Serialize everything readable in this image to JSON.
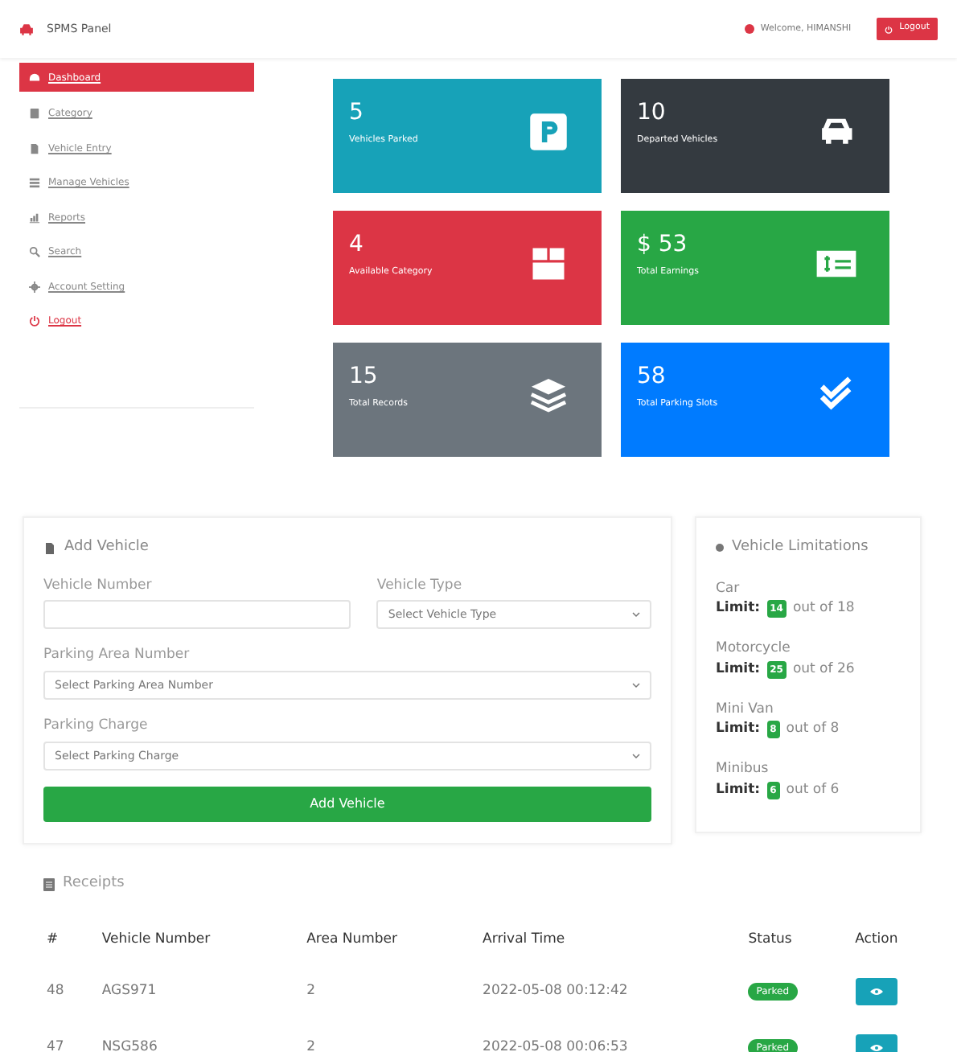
{
  "navbar": {
    "brand": "SPMS Panel",
    "welcome": "Welcome, HIMANSHI",
    "logout": "Logout"
  },
  "sidebar": {
    "items": [
      {
        "label": "Dashboard",
        "kind": "dashboard",
        "selected": true
      },
      {
        "label": "Category",
        "kind": "category",
        "selected": false
      },
      {
        "label": "Vehicle Entry",
        "kind": "entry",
        "selected": false
      },
      {
        "label": "Manage Vehicles",
        "kind": "manage",
        "selected": false
      },
      {
        "label": "Reports",
        "kind": "reports",
        "selected": false
      },
      {
        "label": "Search",
        "kind": "search",
        "selected": false
      },
      {
        "label": "Account Setting",
        "kind": "settings",
        "selected": false
      },
      {
        "label": "Logout",
        "kind": "logout",
        "selected": false
      }
    ]
  },
  "stats": [
    {
      "value": "5",
      "label": "Vehicles Parked",
      "kind": "parking",
      "color": "#17a2b8"
    },
    {
      "value": "10",
      "label": "Departed Vehicles",
      "kind": "car",
      "color": "#343a40"
    },
    {
      "value": "4",
      "label": "Available Category",
      "kind": "box",
      "color": "#dc3545"
    },
    {
      "value": "$ 53",
      "label": "Total Earnings",
      "kind": "money",
      "color": "#28a745"
    },
    {
      "value": "15",
      "label": "Total Records",
      "kind": "layers",
      "color": "#6c757d"
    },
    {
      "value": "58",
      "label": "Total Parking Slots",
      "kind": "check",
      "color": "#007bff"
    }
  ],
  "add_vehicle": {
    "title": "Add Vehicle",
    "vehicle_number_label": "Vehicle Number",
    "vehicle_type_label": "Vehicle Type",
    "vehicle_type_placeholder": "Select Vehicle Type",
    "area_label": "Parking Area Number",
    "area_placeholder": "Select Parking Area Number",
    "charge_label": "Parking Charge",
    "charge_placeholder": "Select Parking Charge",
    "button": "Add Vehicle"
  },
  "limitations": {
    "title": "Vehicle Limitations",
    "items": [
      {
        "name": "Car",
        "limit_label": "Limit:",
        "count": "14",
        "total": "out of 18"
      },
      {
        "name": "Motorcycle",
        "limit_label": "Limit:",
        "count": "25",
        "total": "out of 26"
      },
      {
        "name": "Mini Van",
        "limit_label": "Limit:",
        "count": "8",
        "total": "out of 8"
      },
      {
        "name": "Minibus",
        "limit_label": "Limit:",
        "count": "6",
        "total": "out of 6"
      }
    ]
  },
  "receipts": {
    "title": "Receipts",
    "columns": [
      "#",
      "Vehicle Number",
      "Area Number",
      "Arrival Time",
      "Status",
      "Action"
    ],
    "rows": [
      {
        "id": "48",
        "vehicle": "AGS971",
        "area": "2",
        "arrival": "2022-05-08 00:12:42",
        "status": "Parked"
      },
      {
        "id": "47",
        "vehicle": "NSG586",
        "area": "2",
        "arrival": "2022-05-08 00:06:53",
        "status": "Parked"
      }
    ]
  }
}
